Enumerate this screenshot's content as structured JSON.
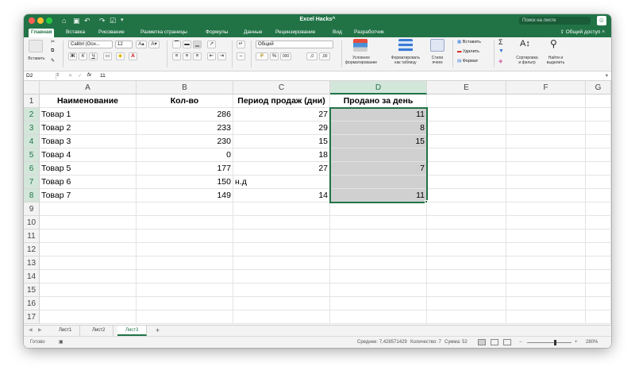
{
  "window": {
    "title": "Excel Hacks^",
    "search_placeholder": "Поиск на листе"
  },
  "ribbon_tabs": [
    "Главная",
    "Вставка",
    "Рисование",
    "Разметка страницы",
    "Формулы",
    "Данные",
    "Рецензирование",
    "Вид",
    "Разработчик"
  ],
  "active_tab": "Главная",
  "share_label": "Общий доступ",
  "ribbon": {
    "paste_label": "Вставить",
    "font_name": "Calibri (Осн...",
    "font_size": "12",
    "number_format": "Общий",
    "cond_format_label": [
      "Условное",
      "форматирование"
    ],
    "table_format_label": [
      "Форматировать",
      "как таблицу"
    ],
    "cell_styles_label": [
      "Стили",
      "ячеек"
    ],
    "insert_label": "Вставить",
    "delete_label": "Удалить",
    "format_label": "Формат",
    "sort_label": [
      "Сортировка",
      "и фильтр"
    ],
    "find_label": [
      "Найти и",
      "выделить"
    ]
  },
  "formula_bar": {
    "cell_ref": "D2",
    "fx": "fx",
    "value": "11"
  },
  "columns": [
    "A",
    "B",
    "C",
    "D",
    "E",
    "F",
    "G"
  ],
  "row_numbers": [
    "1",
    "2",
    "3",
    "4",
    "5",
    "6",
    "7",
    "8",
    "9",
    "10",
    "11",
    "12",
    "13",
    "14",
    "15",
    "16",
    "17"
  ],
  "table": {
    "headers": [
      "Наименование",
      "Кол-во",
      "Период продаж (дни)",
      "Продано за день"
    ],
    "rows": [
      [
        "Товар 1",
        "286",
        "27",
        "11"
      ],
      [
        "Товар 2",
        "233",
        "29",
        "8"
      ],
      [
        "Товар 3",
        "230",
        "15",
        "15"
      ],
      [
        "Товар 4",
        "0",
        "18",
        ""
      ],
      [
        "Товар 5",
        "177",
        "27",
        "7"
      ],
      [
        "Товар 6",
        "150",
        "н.д",
        ""
      ],
      [
        "Товар 7",
        "149",
        "14",
        "11"
      ]
    ]
  },
  "sheets": [
    "Лист1",
    "Лист2",
    "Лист3"
  ],
  "active_sheet": "Лист3",
  "status": {
    "ready": "Готово",
    "average": "Среднее: 7,428571429",
    "count": "Количество: 7",
    "sum": "Сумма: 52",
    "zoom": "280%"
  },
  "colors": {
    "accent": "#217346",
    "selection_fill": "#d0d0d0"
  }
}
